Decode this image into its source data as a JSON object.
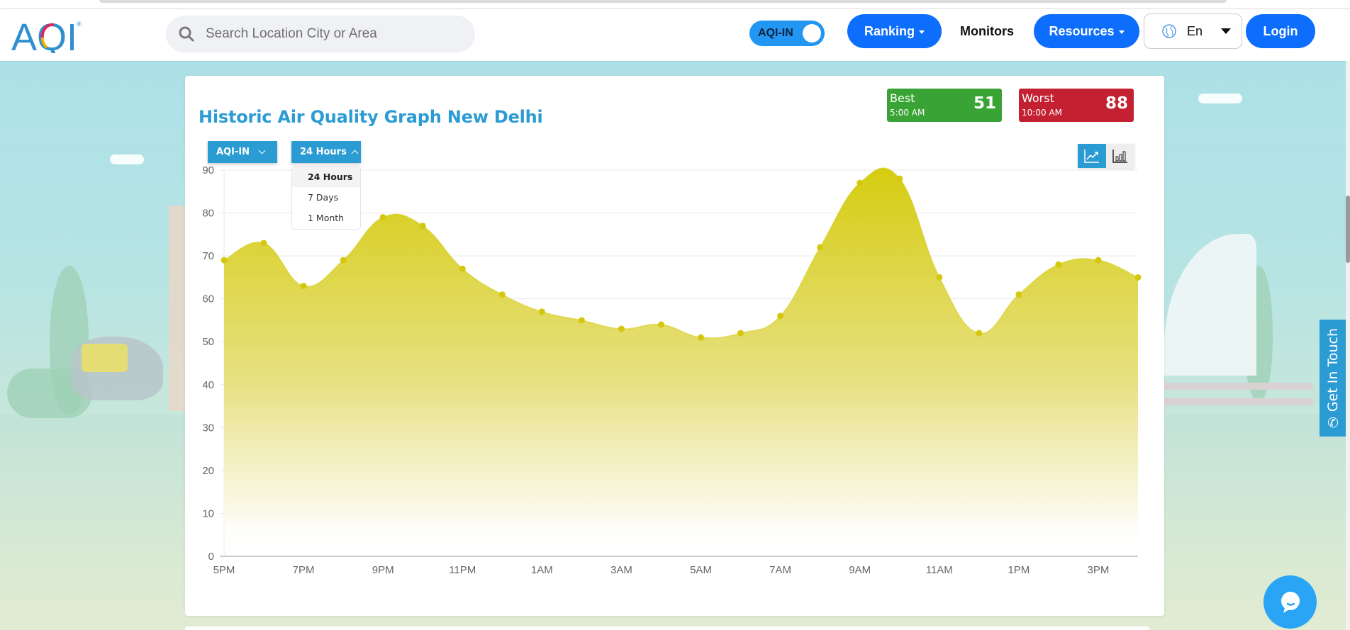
{
  "header": {
    "logo_text": "AQI",
    "search_placeholder": "Search Location City or Area",
    "toggle_label": "AQI-IN",
    "nav": {
      "ranking": "Ranking",
      "monitors": "Monitors",
      "resources": "Resources",
      "language": "En",
      "login": "Login"
    }
  },
  "card": {
    "title": "Historic Air Quality Graph New Delhi",
    "best": {
      "label": "Best",
      "time": "5:00 AM",
      "value": "51",
      "color": "#3aa335"
    },
    "worst": {
      "label": "Worst",
      "time": "10:00 AM",
      "value": "88",
      "color": "#c32032"
    },
    "metric_select": "AQI-IN",
    "range_select": "24 Hours",
    "range_options": [
      "24 Hours",
      "7 Days",
      "1 Month"
    ],
    "range_active_index": 0,
    "view_modes": [
      {
        "name": "line-chart",
        "active": true
      },
      {
        "name": "bar-chart",
        "active": false
      }
    ]
  },
  "side": {
    "get_in_touch": "Get In Touch"
  },
  "colors": {
    "accent": "#2b9bd3",
    "nav_blue": "#0d6efd",
    "area_fill": "#d7cf1a",
    "point": "#d4c80e"
  },
  "chart_data": {
    "type": "area",
    "title": "Historic Air Quality Graph New Delhi",
    "xlabel": "",
    "ylabel": "",
    "x": [
      "5PM",
      "6PM",
      "7PM",
      "8PM",
      "9PM",
      "10PM",
      "11PM",
      "12AM",
      "1AM",
      "2AM",
      "3AM",
      "4AM",
      "5AM",
      "6AM",
      "7AM",
      "8AM",
      "9AM",
      "10AM",
      "11AM",
      "12PM",
      "1PM",
      "2PM",
      "3PM",
      "4PM"
    ],
    "x_tick_labels": [
      "5PM",
      "7PM",
      "9PM",
      "11PM",
      "1AM",
      "3AM",
      "5AM",
      "7AM",
      "9AM",
      "11AM",
      "1PM",
      "3PM"
    ],
    "series": [
      {
        "name": "AQI-IN",
        "values": [
          69,
          73,
          63,
          69,
          79,
          77,
          67,
          61,
          57,
          55,
          53,
          54,
          51,
          52,
          56,
          72,
          87,
          88,
          65,
          52,
          61,
          68,
          69,
          65
        ]
      }
    ],
    "ylim": [
      0,
      90
    ],
    "y_ticks": [
      0,
      10,
      20,
      30,
      40,
      50,
      60,
      70,
      80,
      90
    ],
    "grid": true,
    "legend": "none",
    "smooth": true
  }
}
